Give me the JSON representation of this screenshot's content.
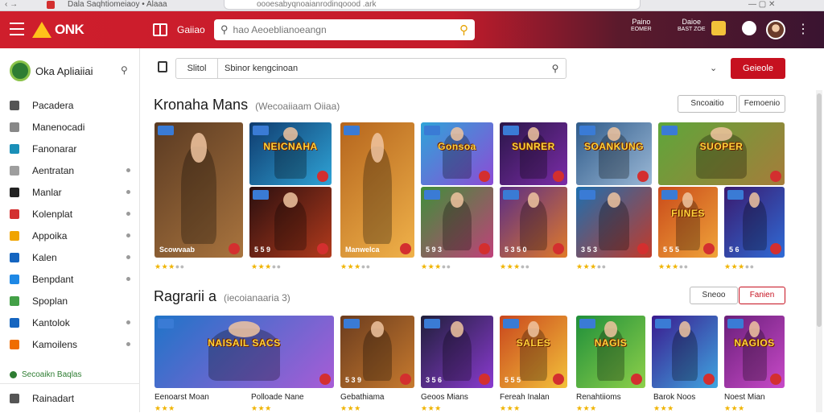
{
  "browser": {
    "tab_title": "Dala Saqhtiomeiaoy • Alaaa",
    "url": "oooesabyqnoaianrodinqoood .ark",
    "nav_arrows": "‹  →",
    "controls": "— ▢ ✕"
  },
  "header": {
    "logo_text": "ONK",
    "link_label": "Gaiiao",
    "search_placeholder": "hao Aeoeblianoeangn",
    "right_items": [
      {
        "line1": "Paino",
        "line2": "EOMER"
      },
      {
        "line1": "Daioe",
        "line2": "BAST ZOE"
      }
    ]
  },
  "sidebar": {
    "title": "Oka Apliaiiai",
    "items": [
      {
        "label": "Pacadera",
        "color": "#555555",
        "dot": false
      },
      {
        "label": "Manenocadi",
        "color": "#888888",
        "dot": false
      },
      {
        "label": "Fanonarar",
        "color": "#1a8fb8",
        "dot": false
      },
      {
        "label": "Aentratan",
        "color": "#9e9e9e",
        "dot": true
      },
      {
        "label": "Manlar",
        "color": "#222222",
        "dot": true
      },
      {
        "label": "Kolenplat",
        "color": "#d32f2f",
        "dot": true
      },
      {
        "label": "Appoika",
        "color": "#f0a400",
        "dot": true
      },
      {
        "label": "Kalen",
        "color": "#1565c0",
        "dot": true
      },
      {
        "label": "Benpdant",
        "color": "#1e88e5",
        "dot": true
      },
      {
        "label": "Spoplan",
        "color": "#43a047",
        "dot": false
      },
      {
        "label": "Kantolok",
        "color": "#1565c0",
        "dot": true
      },
      {
        "label": "Kamoilens",
        "color": "#ef6c00",
        "dot": true
      }
    ],
    "section_label": "Secoaikn Baqlas",
    "footer_item": {
      "label": "Rainadart",
      "color": "#555555"
    }
  },
  "toolbar": {
    "filter_label": "Slitol",
    "filter_value": "Sbinor kengcinoan",
    "primary_button": "Geieole"
  },
  "section1": {
    "title": "Kronaha Mans",
    "subtitle": "(Wecoaiiaam Oiiaa)",
    "btn1": "Sncoaitio",
    "btn2": "Femoenio",
    "tiles": [
      {
        "title": "",
        "num": "Scowvaab",
        "c1": "#5a3a22",
        "c2": "#a9743e",
        "accent": "#f2a93b"
      },
      {
        "title": "NEICNAHA",
        "num": "",
        "c1": "#0f3b6e",
        "c2": "#2fa3d6",
        "accent": "#ffd43b"
      },
      {
        "title": "",
        "num": "5 5 9",
        "c1": "#2a0f0f",
        "c2": "#b23a1c",
        "accent": "#ff7a2a"
      },
      {
        "title": "",
        "num": "Manwelca",
        "c1": "#b5651d",
        "c2": "#f0b24a",
        "accent": "#ffe08a"
      },
      {
        "title": "Gonsoa",
        "num": "",
        "c1": "#2fa4d8",
        "c2": "#8d4bd6",
        "accent": "#ffd43b"
      },
      {
        "title": "",
        "num": "5 9 3",
        "c1": "#3f8f3a",
        "c2": "#c0417a",
        "accent": "#ffd43b"
      },
      {
        "title": "SUNRER",
        "num": "",
        "c1": "#2a1648",
        "c2": "#7b2ca8",
        "accent": "#ffd43b"
      },
      {
        "title": "",
        "num": "5 3 5 0",
        "c1": "#5a2d86",
        "c2": "#e07a2a",
        "accent": "#ffd43b"
      },
      {
        "title": "SOANKUNG",
        "num": "",
        "c1": "#2f5b8a",
        "c2": "#9bb8d6",
        "accent": "#ffd43b"
      },
      {
        "title": "",
        "num": "3 5 3",
        "c1": "#1d6fb0",
        "c2": "#c23a2a",
        "accent": "#ffd43b"
      },
      {
        "title": "SUOPER",
        "num": "",
        "c1": "#5ea63a",
        "c2": "#a67c3a",
        "accent": "#ffd43b"
      },
      {
        "title": "FIINES",
        "num": "5 5 5",
        "c1": "#c94a1a",
        "c2": "#f0a43a",
        "accent": "#ffd43b"
      },
      {
        "title": "",
        "num": "5 6",
        "c1": "#3a1a6e",
        "c2": "#2f6bd6",
        "accent": "#ffd43b"
      }
    ],
    "ratings": [
      3,
      3,
      3,
      3,
      3,
      3,
      3,
      3
    ]
  },
  "section2": {
    "title": "Ragrarii a",
    "subtitle": "(iecoianaaria 3)",
    "btn1": "Sneoo",
    "btn2": "Fanien",
    "tiles": [
      {
        "title": "NAISAIL SACS",
        "num": "",
        "c1": "#1f74c8",
        "c2": "#a85cd6",
        "accent": "#ffd43b"
      },
      {
        "title": "",
        "num": "5 3 9",
        "c1": "#6b3c1e",
        "c2": "#c77a2e",
        "accent": "#ffd43b"
      },
      {
        "title": "",
        "num": "3 5 6",
        "c1": "#1f1f3a",
        "c2": "#8a3ad0",
        "accent": "#ffd43b"
      },
      {
        "title": "SALES",
        "num": "5 5 5",
        "c1": "#c9461d",
        "c2": "#f3c23a",
        "accent": "#ffd43b"
      },
      {
        "title": "NAGIS",
        "num": "",
        "c1": "#1f8f3a",
        "c2": "#8ed04a",
        "accent": "#ffd43b"
      },
      {
        "title": "",
        "num": "",
        "c1": "#3a1a8e",
        "c2": "#3fa6e0",
        "accent": "#ffd43b"
      },
      {
        "title": "NAGIOS",
        "num": "",
        "c1": "#6a1f7a",
        "c2": "#c84ac8",
        "accent": "#ffd43b"
      }
    ],
    "captions": [
      "Eenoarst Moan",
      "Polloade Nane",
      "Gebathiama",
      "Geoos Mians",
      "Fereah Inalan",
      "Renahtiioms",
      "Barok Noos",
      "Noest Mian"
    ]
  }
}
